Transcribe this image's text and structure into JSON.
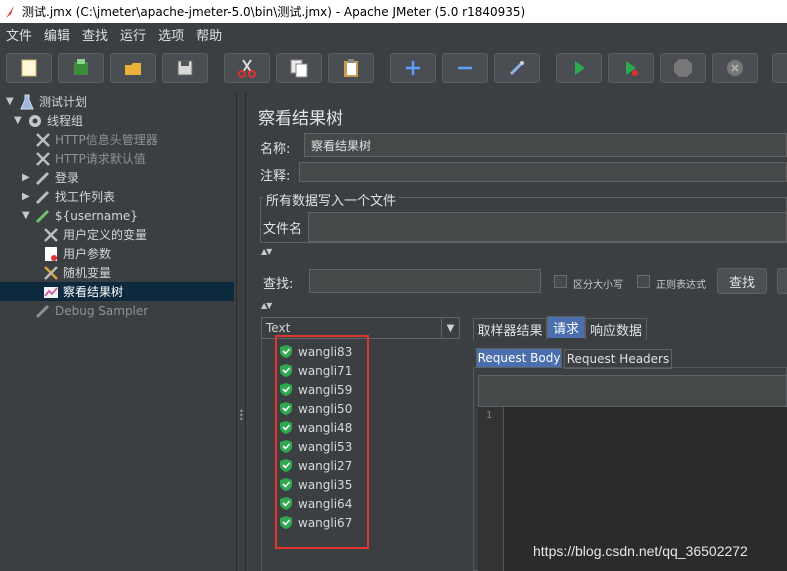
{
  "window": {
    "title": "测试.jmx (C:\\jmeter\\apache-jmeter-5.0\\bin\\测试.jmx) - Apache JMeter (5.0 r1840935)"
  },
  "menu": [
    "文件",
    "编辑",
    "查找",
    "运行",
    "选项",
    "帮助"
  ],
  "toolbar": [
    {
      "name": "new-icon"
    },
    {
      "name": "templates-icon"
    },
    {
      "name": "open-icon"
    },
    {
      "name": "save-icon"
    },
    {
      "name": "cut-icon"
    },
    {
      "name": "copy-icon"
    },
    {
      "name": "paste-icon"
    },
    {
      "name": "expand-icon"
    },
    {
      "name": "collapse-icon"
    },
    {
      "name": "toggle-icon"
    },
    {
      "name": "start-icon"
    },
    {
      "name": "start-no-pauses-icon"
    },
    {
      "name": "stop-icon"
    },
    {
      "name": "shutdown-icon"
    }
  ],
  "tree": [
    {
      "label": "测试计划",
      "icon": "test-plan-icon",
      "arrow": "▼"
    },
    {
      "label": "线程组",
      "icon": "thread-group-icon",
      "arrow": "▼"
    },
    {
      "label": "HTTP信息头管理器",
      "icon": "config-tools-icon",
      "arrow": "",
      "dim": true
    },
    {
      "label": "HTTP请求默认值",
      "icon": "config-tools-icon",
      "arrow": "",
      "dim": true
    },
    {
      "label": "登录",
      "icon": "sampler-pen-icon",
      "arrow": "▶"
    },
    {
      "label": "找工作列表",
      "icon": "sampler-pen-icon",
      "arrow": "▶"
    },
    {
      "label": "${username}",
      "icon": "sampler-pen-icon",
      "arrow": "▼"
    },
    {
      "label": "用户定义的变量",
      "icon": "config-tools-icon",
      "arrow": ""
    },
    {
      "label": "用户参数",
      "icon": "pre-processor-icon",
      "arrow": ""
    },
    {
      "label": "随机变量",
      "icon": "config-tools-icon",
      "arrow": ""
    },
    {
      "label": "察看结果树",
      "icon": "listener-chart-icon",
      "arrow": "",
      "selected": true
    },
    {
      "label": "Debug Sampler",
      "icon": "sampler-pen-icon",
      "arrow": "",
      "dim": true
    }
  ],
  "panel": {
    "title": "察看结果树",
    "name_label": "名称:",
    "name_value": "察看结果树",
    "comment_label": "注释:",
    "file_group_title": "所有数据写入一个文件",
    "file_label": "文件名",
    "search_label": "查找:",
    "case_sensitive_label": "区分大小写",
    "regex_label": "正则表达式",
    "search_button": "查找"
  },
  "results": {
    "renderer": "Text",
    "items": [
      "wangli83",
      "wangli71",
      "wangli59",
      "wangli50",
      "wangli48",
      "wangli53",
      "wangli27",
      "wangli35",
      "wangli64",
      "wangli67"
    ],
    "status_color": "#2fa84f"
  },
  "tabs": [
    "取样器结果",
    "请求",
    "响应数据"
  ],
  "active_tab": "请求",
  "subtabs": [
    "Request Body",
    "Request Headers"
  ],
  "editor": {
    "line": "1"
  },
  "watermark": "https://blog.csdn.net/qq_36502272",
  "colors": {
    "highlight_box": "#e0342f",
    "selection": "#0d293e",
    "active_tab": "#4b6eaf"
  }
}
